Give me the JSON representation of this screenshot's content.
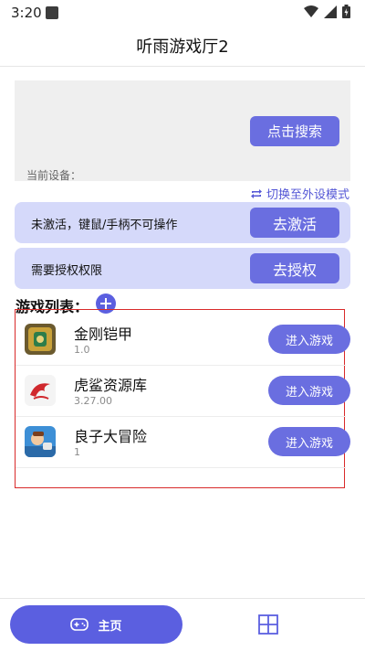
{
  "status_bar": {
    "time": "3:20"
  },
  "title": "听雨游戏厅2",
  "device_panel": {
    "search_button": "点击搜索",
    "device_label": "当前设备：",
    "switch_mode": "切换至外设模式"
  },
  "activation": {
    "text": "未激活，键鼠/手柄不可操作",
    "button": "去激活"
  },
  "authorization": {
    "text": "需要授权权限",
    "button": "去授权"
  },
  "game_list": {
    "title": "游戏列表：",
    "items": [
      {
        "name": "金刚铠甲",
        "version": "1.0",
        "button": "进入游戏"
      },
      {
        "name": "虎鲨资源库",
        "version": "3.27.00",
        "button": "进入游戏"
      },
      {
        "name": "良子大冒险",
        "version": "1",
        "button": "进入游戏"
      }
    ]
  },
  "bottom_nav": {
    "home": "主页"
  },
  "colors": {
    "accent": "#6a6ee0",
    "card": "#d5d9fa",
    "highlight_border": "#d92a2a"
  }
}
